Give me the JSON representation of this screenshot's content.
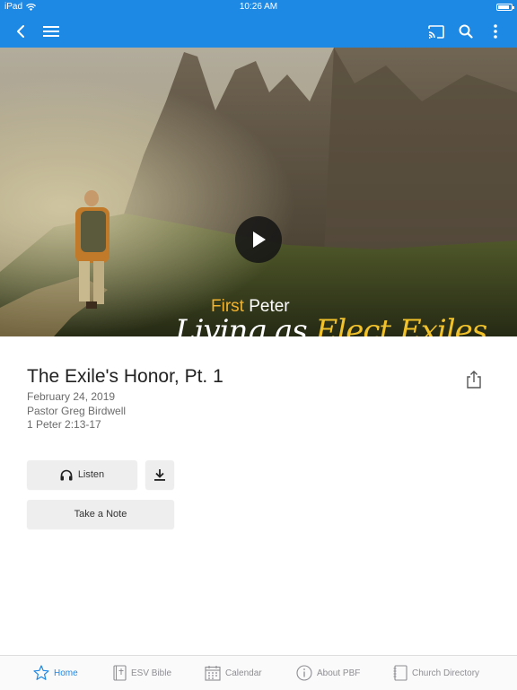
{
  "status_bar": {
    "device": "iPad",
    "time": "10:26 AM",
    "battery_level": 0.85
  },
  "app_bar": {
    "back_icon": "chevron-left-icon",
    "menu_icon": "hamburger-menu-icon",
    "cast_icon": "cast-icon",
    "search_icon": "search-icon",
    "more_icon": "more-vertical-icon",
    "background_color": "#1e88e5"
  },
  "hero": {
    "series_prefix": "First",
    "series_name": "Peter",
    "subtitle_part1": "Living as",
    "subtitle_part2": "Elect Exiles",
    "play_icon": "play-icon"
  },
  "sermon": {
    "title": "The Exile's Honor, Pt. 1",
    "date": "February 24, 2019",
    "speaker": "Pastor Greg Birdwell",
    "passage": "1 Peter 2:13-17",
    "share_icon": "share-icon"
  },
  "actions": {
    "listen_label": "Listen",
    "listen_icon": "headphones-icon",
    "download_icon": "download-icon",
    "note_label": "Take a Note"
  },
  "tabs": [
    {
      "label": "Home",
      "icon": "star-icon",
      "active": true
    },
    {
      "label": "ESV Bible",
      "icon": "bible-icon",
      "active": false
    },
    {
      "label": "Calendar",
      "icon": "calendar-icon",
      "active": false
    },
    {
      "label": "About PBF",
      "icon": "info-icon",
      "active": false
    },
    {
      "label": "Church Directory",
      "icon": "directory-icon",
      "active": false
    }
  ],
  "colors": {
    "accent": "#1e88e5",
    "gold": "#f2b22e",
    "inactive": "#8e8e93"
  }
}
